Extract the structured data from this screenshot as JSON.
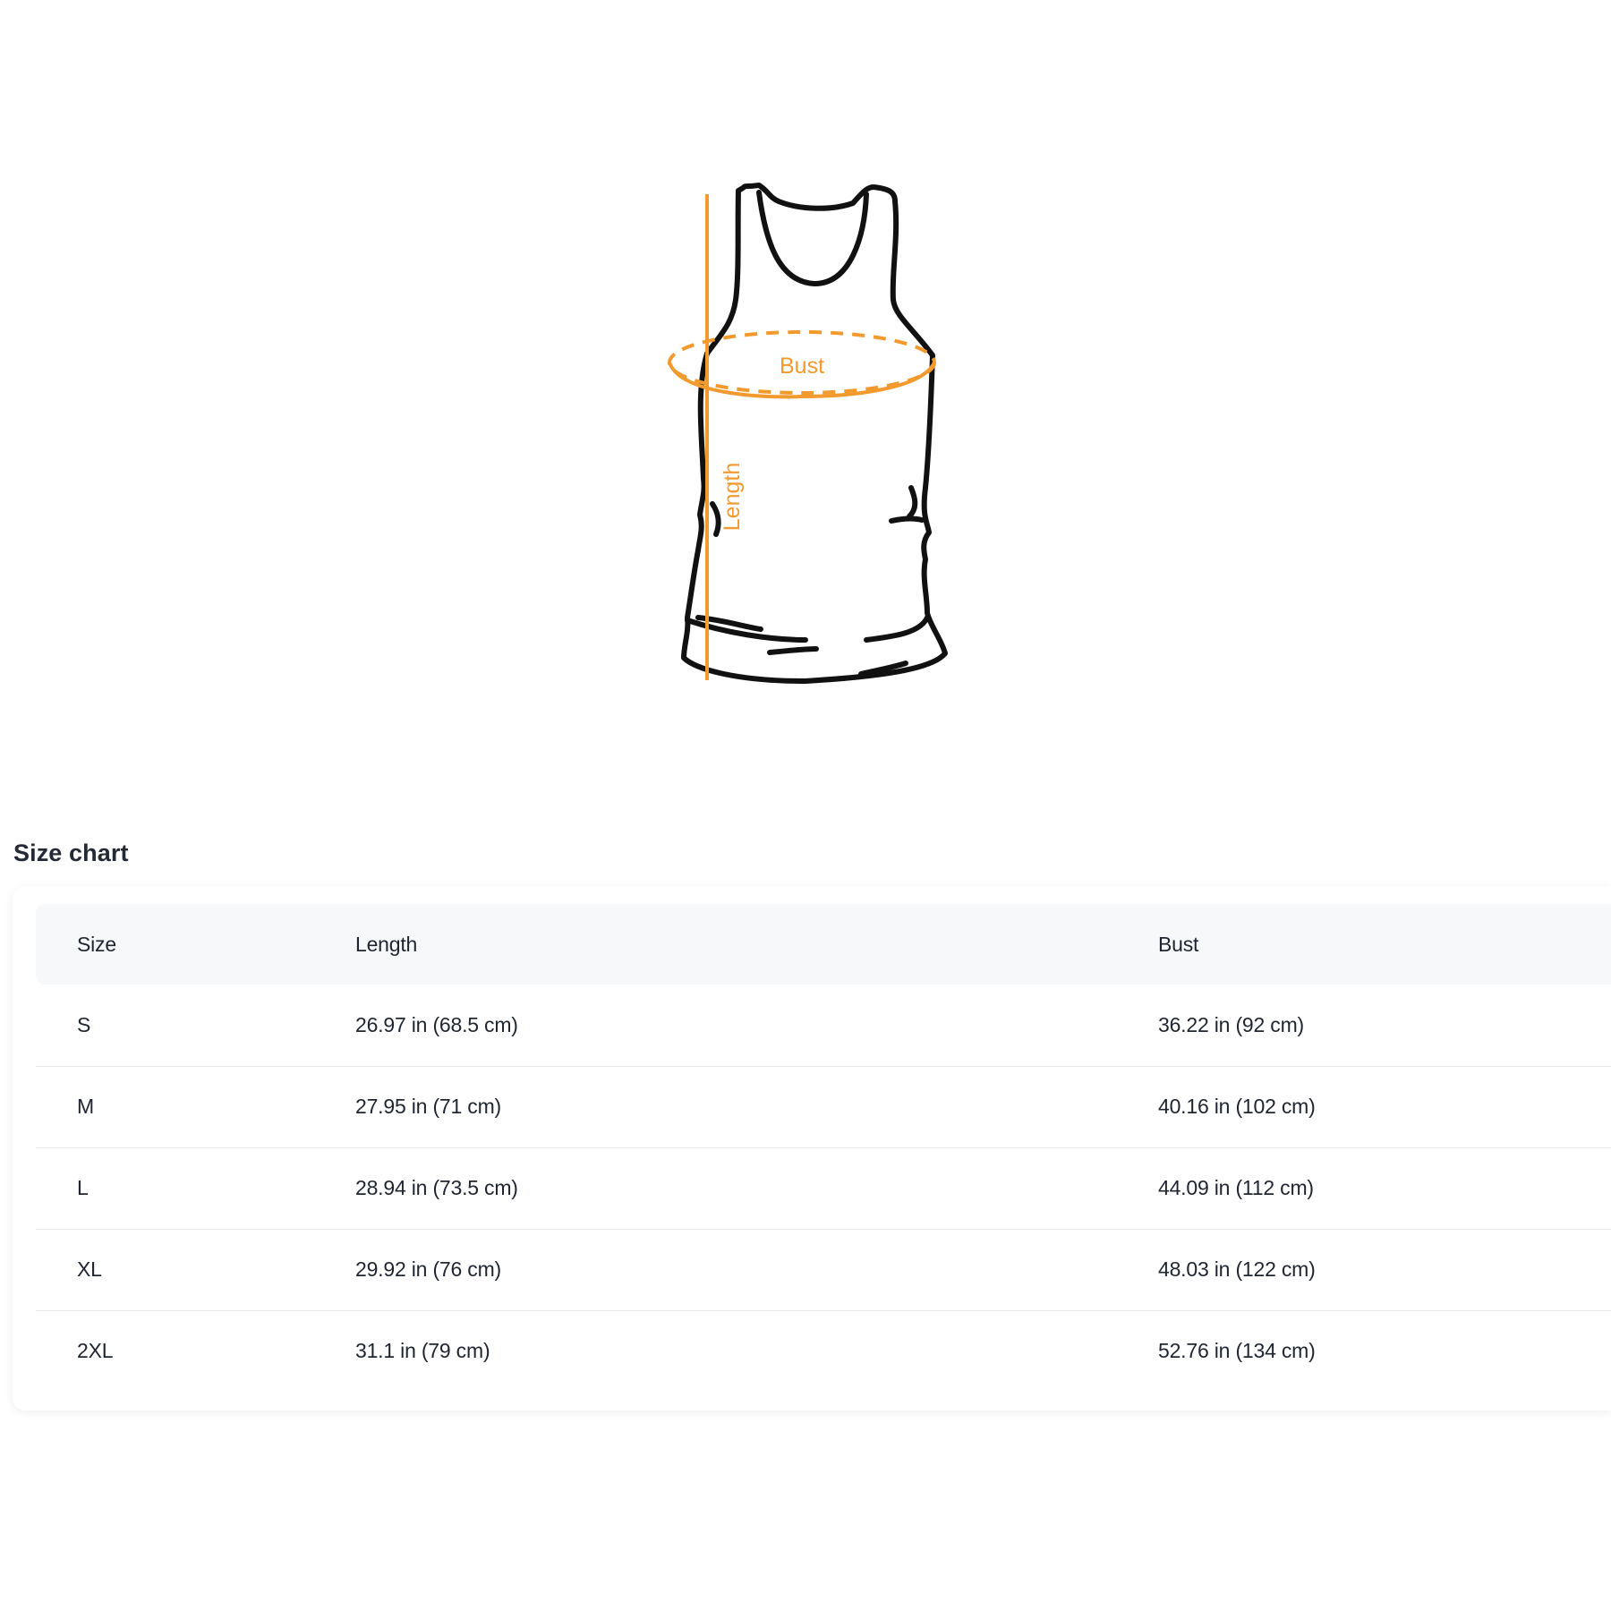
{
  "illustration": {
    "bust_label": "Bust",
    "length_label": "Length",
    "accent_color": "#f29a2e",
    "outline_color": "#111111"
  },
  "size_chart": {
    "title": "Size chart",
    "columns": [
      "Size",
      "Length",
      "Bust"
    ],
    "rows": [
      {
        "size": "S",
        "length": "26.97 in  (68.5 cm)",
        "bust": "36.22 in  (92 cm)"
      },
      {
        "size": "M",
        "length": "27.95 in  (71 cm)",
        "bust": "40.16 in  (102 cm)"
      },
      {
        "size": "L",
        "length": "28.94 in  (73.5 cm)",
        "bust": "44.09 in  (112 cm)"
      },
      {
        "size": "XL",
        "length": "29.92 in  (76 cm)",
        "bust": "48.03 in  (122 cm)"
      },
      {
        "size": "2XL",
        "length": "31.1 in  (79 cm)",
        "bust": "52.76 in  (134 cm)"
      }
    ]
  }
}
